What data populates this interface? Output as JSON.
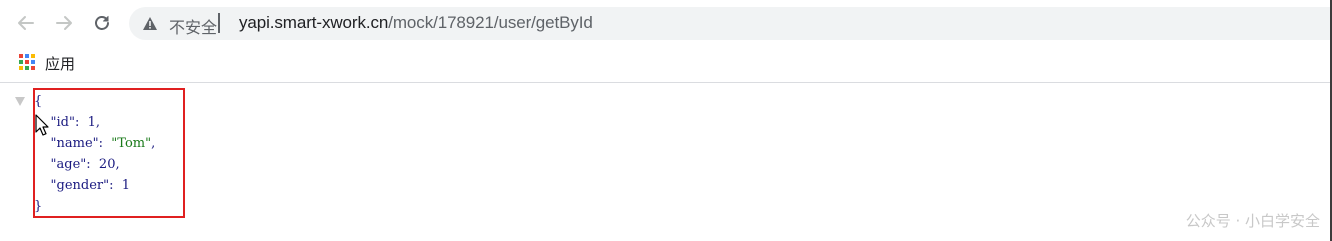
{
  "browser": {
    "security_label": "不安全",
    "url_host": "yapi.smart-xwork.cn",
    "url_path": "/mock/178921/user/getById"
  },
  "bookmarks": {
    "apps_label": "应用"
  },
  "json": {
    "open_brace": "{",
    "close_brace": "}",
    "fields": [
      {
        "key": "\"id\"",
        "value": "1",
        "type": "number",
        "comma": ","
      },
      {
        "key": "\"name\"",
        "value": "\"Tom\"",
        "type": "string",
        "comma": ","
      },
      {
        "key": "\"age\"",
        "value": "20",
        "type": "number",
        "comma": ","
      },
      {
        "key": "\"gender\"",
        "value": "1",
        "type": "number",
        "comma": ""
      }
    ]
  },
  "watermark": "公众号 · 小白学安全",
  "colors": {
    "highlight": "#e02020",
    "json_text": "#1a1a80",
    "json_string": "#1a7a1a"
  }
}
